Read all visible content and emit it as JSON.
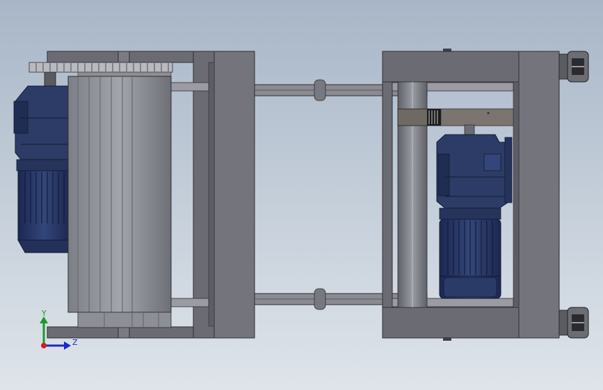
{
  "viewport": {
    "background_top": "#a8b6c7",
    "background_bottom": "#dfe4ea"
  },
  "colors": {
    "frame": "#6b6c73",
    "frame_dark": "#3e3f45",
    "frame_light": "#8a8b92",
    "rail": "#9a9ba3",
    "motor": "#2a3a62",
    "motor_dark": "#161f3a",
    "roller": "#8e9097",
    "axis_x": "#d02020",
    "axis_y": "#1a9a2a",
    "axis_z": "#1a2ac8"
  },
  "triad": {
    "y_label": "Y",
    "z_label": "Z"
  }
}
